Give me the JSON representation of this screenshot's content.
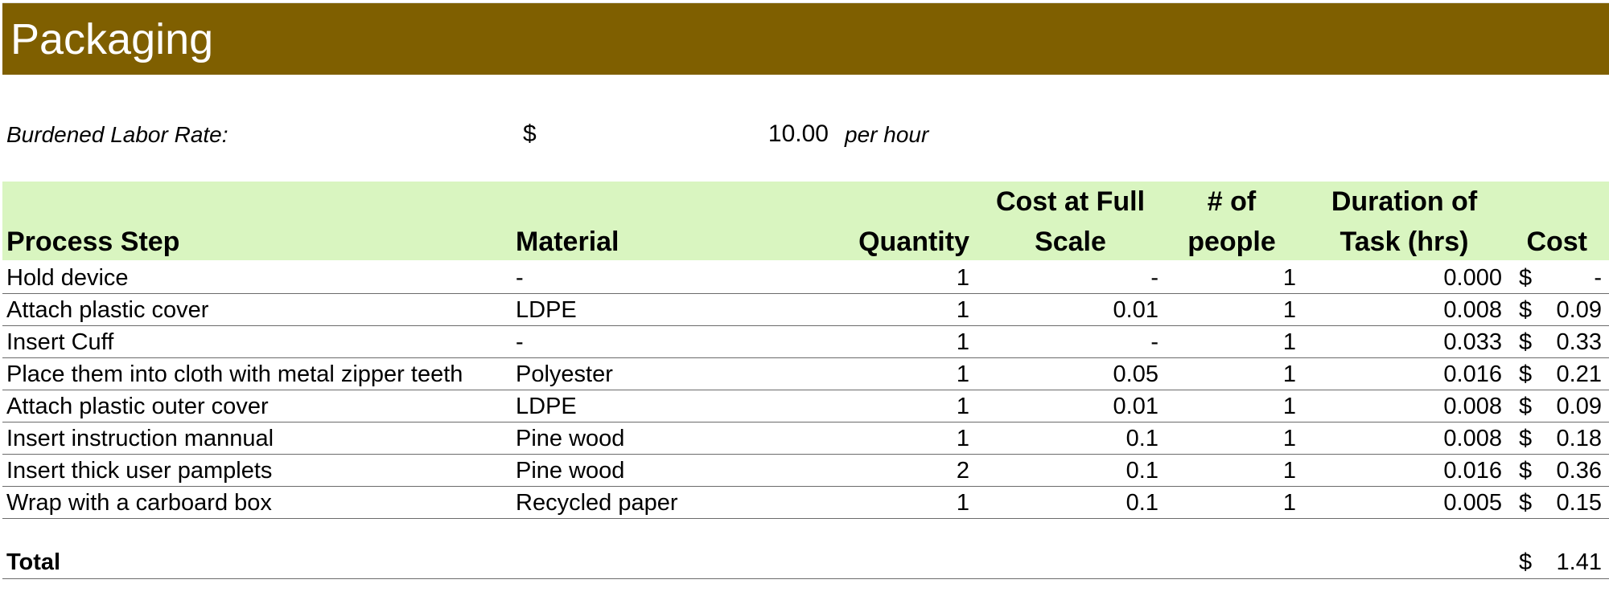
{
  "sheet": {
    "title": "Packaging",
    "title_bg": "#7f5f00",
    "header_bg": "#d9f5c0"
  },
  "labor": {
    "label": "Burdened Labor Rate:",
    "currency": "$",
    "value": "10.00",
    "unit": "per hour"
  },
  "table": {
    "headers": {
      "process_step": "Process Step",
      "material": "Material",
      "quantity": "Quantity",
      "cost_full_line1": "Cost at Full",
      "cost_full_line2": "Scale",
      "people_line1": "# of",
      "people_line2": "people",
      "duration_line1": "Duration of",
      "duration_line2": "Task (hrs)",
      "cost": "Cost"
    },
    "rows": [
      {
        "step": "Hold device",
        "material": "-",
        "quantity": "1",
        "cost_full": "-",
        "people": "1",
        "duration": "0.000",
        "currency": "$",
        "cost": "-"
      },
      {
        "step": "Attach plastic cover",
        "material": "LDPE",
        "quantity": "1",
        "cost_full": "0.01",
        "people": "1",
        "duration": "0.008",
        "currency": "$",
        "cost": "0.09"
      },
      {
        "step": "Insert Cuff",
        "material": "-",
        "quantity": "1",
        "cost_full": "-",
        "people": "1",
        "duration": "0.033",
        "currency": "$",
        "cost": "0.33"
      },
      {
        "step": "Place them into cloth with metal zipper teeth",
        "material": "Polyester",
        "quantity": "1",
        "cost_full": "0.05",
        "people": "1",
        "duration": "0.016",
        "currency": "$",
        "cost": "0.21"
      },
      {
        "step": "Attach plastic outer cover",
        "material": "LDPE",
        "quantity": "1",
        "cost_full": "0.01",
        "people": "1",
        "duration": "0.008",
        "currency": "$",
        "cost": "0.09"
      },
      {
        "step": "Insert instruction mannual",
        "material": "Pine wood",
        "quantity": "1",
        "cost_full": "0.1",
        "people": "1",
        "duration": "0.008",
        "currency": "$",
        "cost": "0.18"
      },
      {
        "step": "Insert thick user pamplets",
        "material": "Pine wood",
        "quantity": "2",
        "cost_full": "0.1",
        "people": "1",
        "duration": "0.016",
        "currency": "$",
        "cost": "0.36"
      },
      {
        "step": "Wrap with a carboard box",
        "material": "Recycled paper",
        "quantity": "1",
        "cost_full": "0.1",
        "people": "1",
        "duration": "0.005",
        "currency": "$",
        "cost": "0.15"
      }
    ],
    "total": {
      "label": "Total",
      "currency": "$",
      "value": "1.41"
    }
  }
}
